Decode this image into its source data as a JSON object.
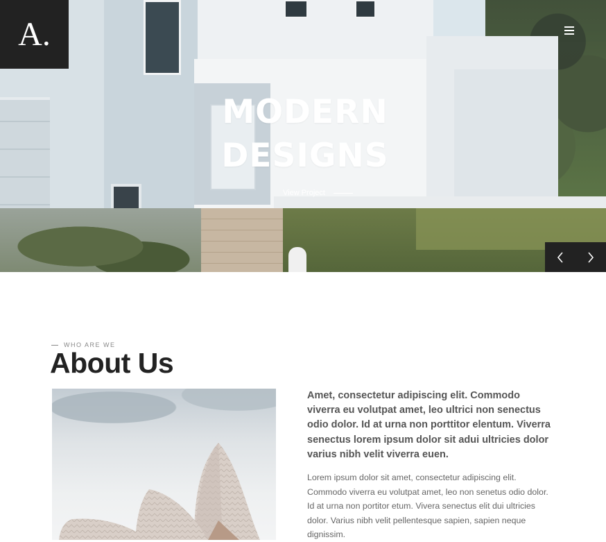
{
  "brand": {
    "logo_text": "A."
  },
  "header": {
    "menu_icon": "hamburger-menu-icon"
  },
  "hero": {
    "title_line1": "MODERN",
    "title_line2": "DESIGNS",
    "cta_label": "View Project",
    "prev_icon": "chevron-left-icon",
    "next_icon": "chevron-right-icon"
  },
  "about": {
    "eyebrow": "WHO ARE WE",
    "title": "About Us",
    "lead": "Amet, consectetur adipiscing elit. Commodo viverra eu volutpat amet, leo ultrici non senectus odio dolor. Id at urna non porttitor elentum. Viverra senectus lorem ipsum dolor sit adui ultricies dolor varius nibh velit viverra euen.",
    "body": "Lorem ipsum dolor sit amet, consectetur adipiscing elit. Commodo viverra eu volutpat amet, leo non senetus odio dolor. Id at urna non portitor etum. Vivera senectus elit dui ultricies dolor. Varius nibh velit pellentesque sapien, sapien neque dignissim."
  },
  "colors": {
    "dark": "#222222",
    "text": "#555555",
    "muted": "#888888",
    "white": "#ffffff"
  }
}
